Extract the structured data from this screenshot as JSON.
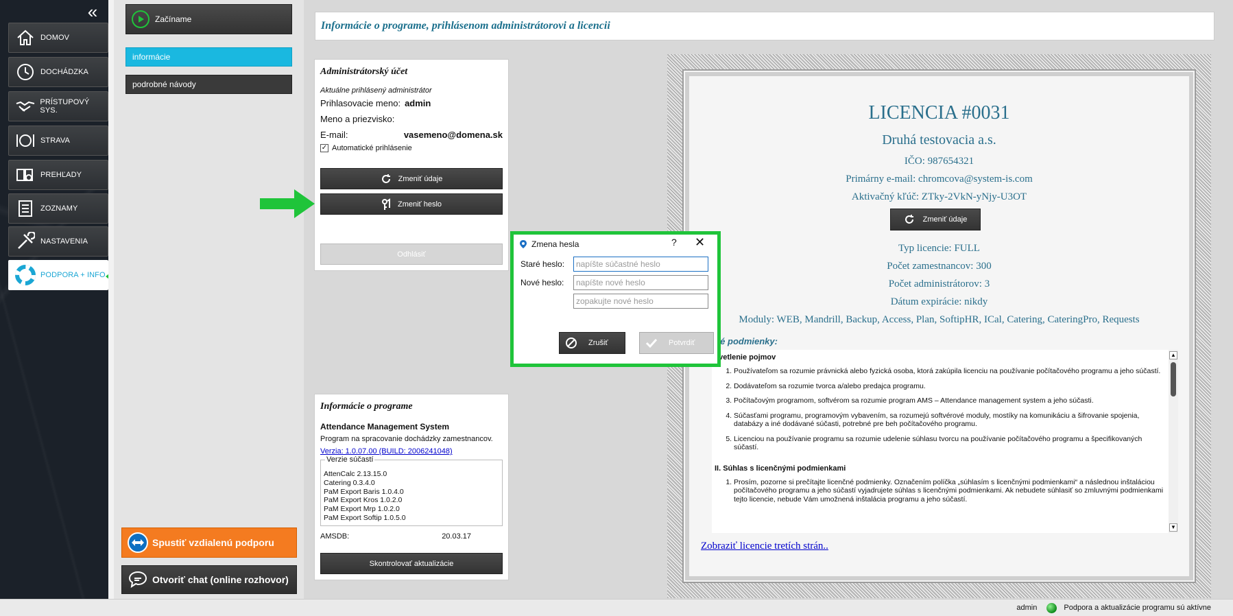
{
  "nav": {
    "collapse_icon": "double-chevron-left-icon",
    "items": [
      {
        "label": "DOMOV",
        "icon": "home-icon"
      },
      {
        "label": "DOCHÁDZKA",
        "icon": "clock-icon"
      },
      {
        "label": "PRÍSTUPOVÝ SYS.",
        "icon": "handshake-icon"
      },
      {
        "label": "STRAVA",
        "icon": "plate-cutlery-icon"
      },
      {
        "label": "PREHĽADY",
        "icon": "magnifier-book-icon"
      },
      {
        "label": "ZOZNAMY",
        "icon": "list-icon"
      },
      {
        "label": "NASTAVENIA",
        "icon": "wrench-screwdriver-icon"
      },
      {
        "label": "PODPORA + INFO",
        "icon": "lifebuoy-icon",
        "active": true
      }
    ]
  },
  "subnav": {
    "start_label": "Začíname",
    "items": [
      {
        "label": "informácie",
        "active": true
      },
      {
        "label": "podrobné návody"
      }
    ],
    "remote_support_label": "Spustiť vzdialenú podporu",
    "chat_label": "Otvoriť chat (online rozhovor)"
  },
  "header": {
    "title": "Informácie o programe, prihlásenom administrátorovi a licencii"
  },
  "admin": {
    "title": "Administrátorský účet",
    "subtitle": "Aktuálne prihlásený administrátor",
    "login_label": "Prihlasovacie meno:",
    "login_value": "admin",
    "name_label": "Meno a priezvisko:",
    "name_value": "",
    "email_label": "E-mail:",
    "email_value": "vasemeno@domena.sk",
    "auto_login_label": "Automatické prihlásenie",
    "auto_login_checked": true,
    "change_details_label": "Zmeniť údaje",
    "change_password_label": "Zmeniť heslo",
    "logout_label": "Odhlásiť"
  },
  "program": {
    "title": "Informácie o programe",
    "app_name": "Attendance Management System",
    "description": "Program na spracovanie dochádzky zamestnancov.",
    "version_link": "Verzia: 1.0.07.00 (BUILD: 2006241048)",
    "components_legend": "Verzie súčastí",
    "components": [
      "AttenCalc 2.13.15.0",
      "Catering 0.3.4.0",
      "PaM Export Baris 1.0.4.0",
      "PaM Export Kros 1.0.2.0",
      "PaM Export Mrp 1.0.2.0",
      "PaM Export Softip 1.0.5.0"
    ],
    "amsdb_label": "AMSDB:",
    "amsdb_value": "20.03.17",
    "check_updates_label": "Skontrolovať aktualizácie"
  },
  "license": {
    "title": "LICENCIA #0031",
    "company": "Druhá testovacia a.s.",
    "ico": "IČO: 987654321",
    "email": "Primárny e-mail: chromcova@system-is.com",
    "activation_key": "Aktivačný kľúč: ZTky-2VkN-yNjy-U3OT",
    "change_details_label": "Zmeniť údaje",
    "type": "Typ licencie: FULL",
    "employees": "Počet zamestnancov: 300",
    "admins": "Počet administrátorov: 3",
    "expiry": "Dátum expirácie: nikdy",
    "modules": "Moduly: WEB, Mandrill, Backup, Access, Plan, SoftipHR, ICal, Catering, CateringPro, Requests",
    "terms_heading": "čné podmienky:",
    "terms_section1": "svetlenie pojmov",
    "terms_items1": [
      "Používateľom sa rozumie právnická alebo fyzická osoba, ktorá zakúpila licenciu na používanie počítačového programu a jeho súčastí.",
      "Dodávateľom sa rozumie tvorca a/alebo predajca programu.",
      "Počítačovým programom, softvérom sa rozumie program AMS – Attendance management system a jeho súčasti.",
      "Súčasťami programu, programovým vybavením, sa rozumejú softvérové moduly, mostíky na komunikáciu a šifrovanie spojenia, databázy a iné dodávané súčasti, potrebné pre beh počítačového programu.",
      "Licenciou na používanie programu sa rozumie udelenie súhlasu tvorcu na používanie počítačového programu a špecifikovaných súčastí."
    ],
    "terms_section2": "II. Súhlas s licenčnými podmienkami",
    "terms_items2": [
      "Prosím, pozorne si prečítajte licenčné podmienky. Označením políčka „súhlasím s licenčnými podmienkami“ a následnou inštaláciou počítačového programu a jeho súčastí vyjadrujete súhlas s licenčnými podmienkami. Ak nebudete súhlasiť so zmluvnými podmienkami tejto licencie, nebude Vám umožnená inštalácia programu a jeho súčastí."
    ],
    "third_party_link": "Zobraziť licencie tretích strán.."
  },
  "dialog": {
    "title": "Zmena hesla",
    "help_label": "?",
    "close_label": "✕",
    "old_label": "Staré heslo:",
    "old_placeholder": "napíšte súčastné heslo",
    "new_label": "Nové heslo:",
    "new_placeholder": "napíšte nové heslo",
    "repeat_placeholder": "zopakujte nové heslo",
    "cancel_label": "Zrušiť",
    "confirm_label": "Potvrdiť"
  },
  "status": {
    "user": "admin",
    "message": "Podpora a aktualizácie programu sú aktívne"
  },
  "colors": {
    "accent": "#1ab8e0",
    "highlight_green": "#1fc43a",
    "remote_orange": "#f47b20",
    "cert_text": "#2a6f8c"
  }
}
